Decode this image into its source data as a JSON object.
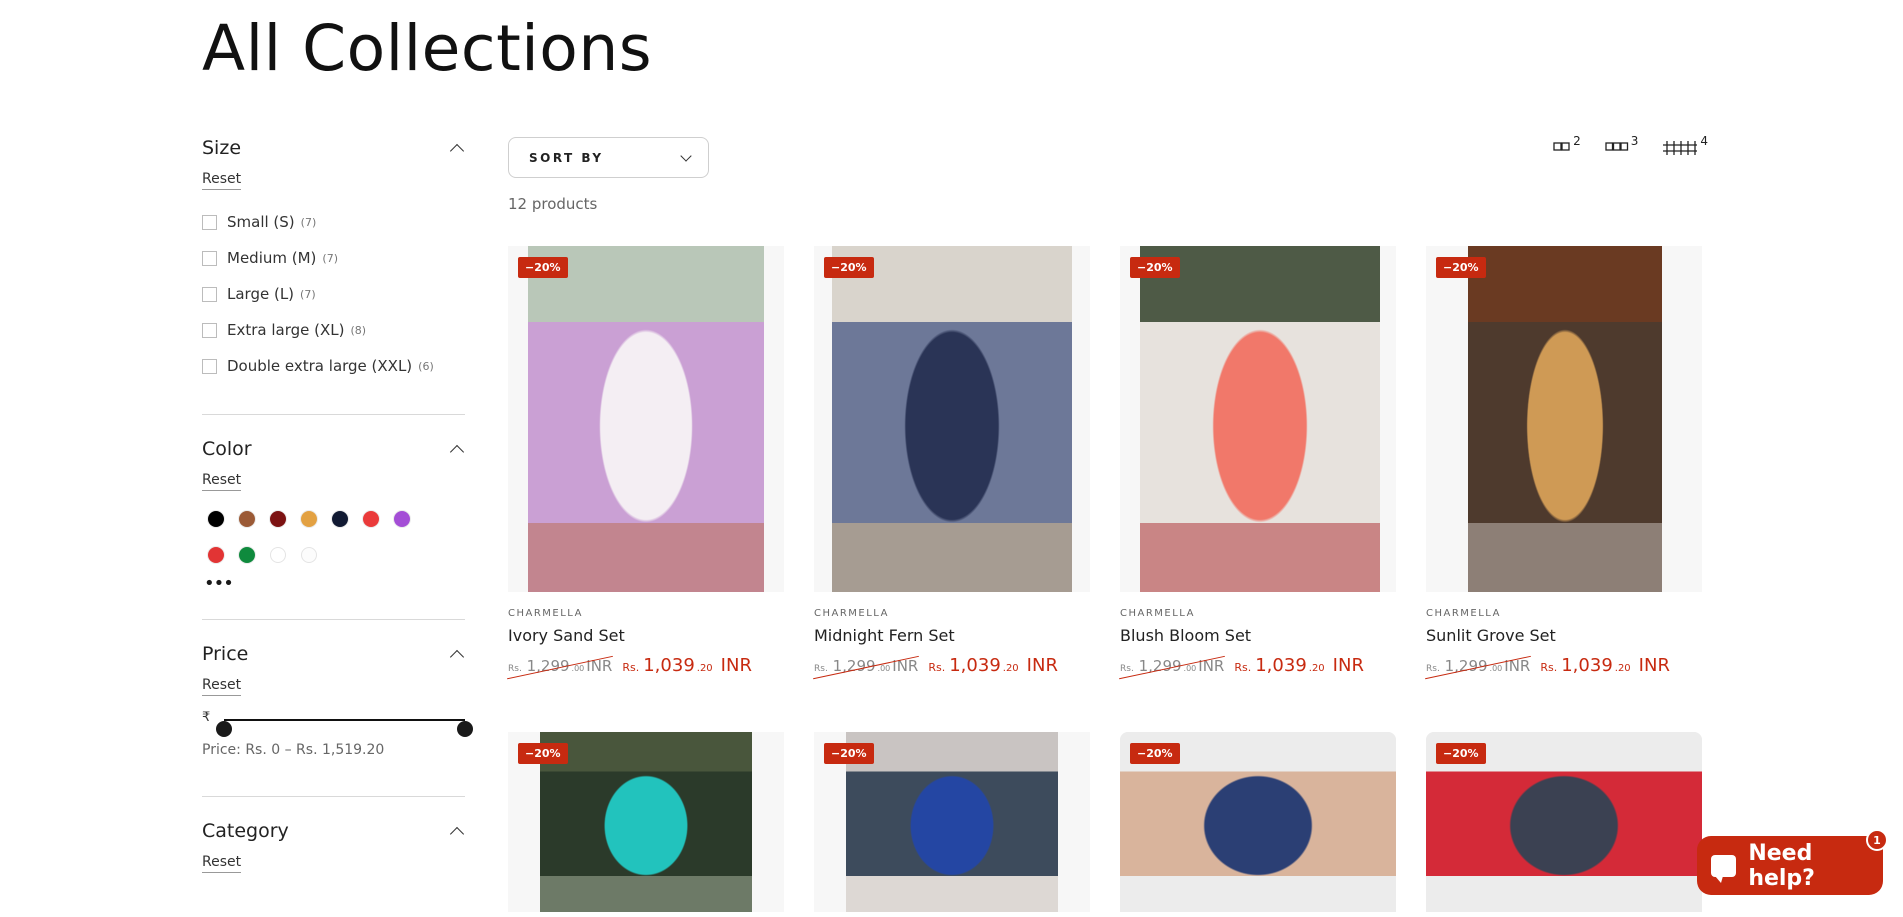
{
  "page": {
    "title": "All Collections"
  },
  "filters": {
    "size": {
      "title": "Size",
      "reset": "Reset",
      "options": [
        {
          "label": "Small (S)",
          "count": "(7)"
        },
        {
          "label": "Medium (M)",
          "count": "(7)"
        },
        {
          "label": "Large (L)",
          "count": "(7)"
        },
        {
          "label": "Extra large (XL)",
          "count": "(8)"
        },
        {
          "label": "Double extra large (XXL)",
          "count": "(6)"
        }
      ]
    },
    "color": {
      "title": "Color",
      "reset": "Reset",
      "swatches": [
        "#000000",
        "#9b5a36",
        "#7c1212",
        "#e3a142",
        "#111a33",
        "#ea3a3a",
        "#a44ed6",
        "#e23434",
        "#0f8a3d",
        "#ffffff",
        "#fcfcfc"
      ],
      "more_label": "•••"
    },
    "price": {
      "title": "Price",
      "reset": "Reset",
      "currency_symbol": "₹",
      "label": "Price: Rs. 0 – Rs. 1,519.20",
      "range_min_fraction": 0,
      "range_max_fraction": 1
    },
    "category": {
      "title": "Category",
      "reset": "Reset"
    }
  },
  "toolbar": {
    "sort_label": "SORT BY",
    "product_count": "12 products",
    "grid_options": [
      "2",
      "3",
      "4"
    ]
  },
  "products": [
    {
      "badge": "−20%",
      "vendor": "CHARMELLA",
      "title": "Ivory Sand Set",
      "old_prefix": "Rs.",
      "old_main": "1,299",
      "old_cents": ".00",
      "old_currency": "INR",
      "new_prefix": "Rs.",
      "new_main": "1,039",
      "new_cents": ".20",
      "new_currency": "INR",
      "colors": [
        "#b9c7b8",
        "#f4eef3",
        "#caa0d4",
        "#c2858f"
      ]
    },
    {
      "badge": "−20%",
      "vendor": "CHARMELLA",
      "title": "Midnight Fern Set",
      "old_prefix": "Rs.",
      "old_main": "1,299",
      "old_cents": ".00",
      "old_currency": "INR",
      "new_prefix": "Rs.",
      "new_main": "1,039",
      "new_cents": ".20",
      "new_currency": "INR",
      "colors": [
        "#d9d4cc",
        "#2a3456",
        "#6d7898",
        "#a69c92"
      ]
    },
    {
      "badge": "−20%",
      "vendor": "CHARMELLA",
      "title": "Blush Bloom Set",
      "old_prefix": "Rs.",
      "old_main": "1,299",
      "old_cents": ".00",
      "old_currency": "INR",
      "new_prefix": "Rs.",
      "new_main": "1,039",
      "new_cents": ".20",
      "new_currency": "INR",
      "colors": [
        "#4e5a46",
        "#f1786a",
        "#e7e2dd",
        "#c98585"
      ]
    },
    {
      "badge": "−20%",
      "vendor": "CHARMELLA",
      "title": "Sunlit Grove Set",
      "old_prefix": "Rs.",
      "old_main": "1,299",
      "old_cents": ".00",
      "old_currency": "INR",
      "new_prefix": "Rs.",
      "new_main": "1,039",
      "new_cents": ".20",
      "new_currency": "INR",
      "colors": [
        "#6a3a22",
        "#cf9a55",
        "#4e3a2d",
        "#8d7f76"
      ]
    },
    {
      "badge": "−20%",
      "colors": [
        "#49563c",
        "#22c3bd",
        "#2b3a2a",
        "#6d7a67"
      ]
    },
    {
      "badge": "−20%",
      "colors": [
        "#c9c4c2",
        "#2446a3",
        "#3d4b5c",
        "#ddd8d4"
      ]
    },
    {
      "badge": "−20%",
      "colors": [
        "#ececec",
        "#2b3f74",
        "#d9b49c",
        "#ececec"
      ]
    },
    {
      "badge": "−20%",
      "colors": [
        "#ececec",
        "#3b4152",
        "#d42a38",
        "#ececec"
      ]
    }
  ],
  "help_widget": {
    "label": "Need help?",
    "badge": "1"
  }
}
